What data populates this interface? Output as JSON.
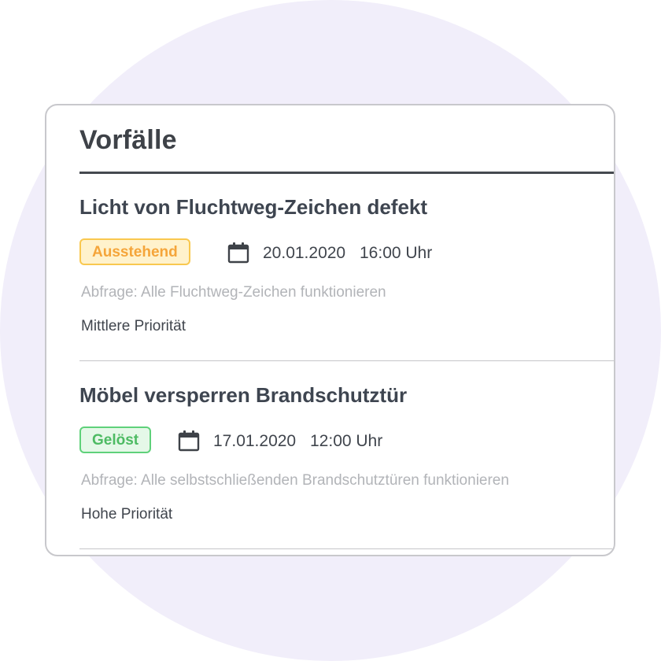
{
  "page": {
    "title": "Vorfälle"
  },
  "incidents": [
    {
      "title": "Licht von Fluchtweg-Zeichen defekt",
      "status": "Ausstehend",
      "status_color": "#f5a53a",
      "icon": "calendar-icon",
      "date": "20.01.2020",
      "time": "16:00 Uhr",
      "query": "Abfrage: Alle Fluchtweg-Zeichen funktionieren",
      "priority": "Mittlere Priorität"
    },
    {
      "title": "Möbel versperren Brandschutztür",
      "status": "Gelöst",
      "status_color": "#4dbb63",
      "icon": "calendar-icon",
      "date": "17.01.2020",
      "time": "12:00 Uhr",
      "query": "Abfrage: Alle selbstschließenden Brandschutztüren funktionieren",
      "priority": "Hohe Priorität"
    }
  ],
  "colors": {
    "background_circle": "#f1eefa",
    "heading": "#3e4248",
    "muted_text": "#b2b4b8"
  }
}
